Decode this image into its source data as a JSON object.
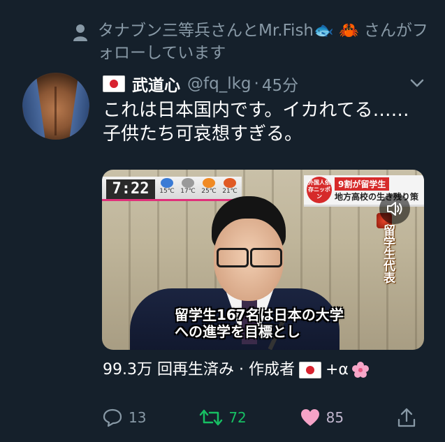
{
  "social_context": {
    "text": "タナブン三等兵さんとMr.Fish🐟 🦀 さんがフォローしています"
  },
  "tweet": {
    "display_name": "武道心",
    "handle": "@fq_lkg",
    "separator": "·",
    "time": "45分",
    "text": "これは日本国内です。イカれてる……子供たち可哀想すぎる。",
    "media": {
      "clock": "7:22",
      "weather": [
        {
          "label": "15℃",
          "icon": "rain-icon",
          "color": "#3a7bd5"
        },
        {
          "label": "17℃",
          "icon": "cloud-icon",
          "color": "#9a9a9a"
        },
        {
          "label": "25℃",
          "icon": "sun-icon",
          "color": "#f08a24"
        },
        {
          "label": "21℃",
          "icon": "sun-cloud-icon",
          "color": "#e05a24"
        }
      ],
      "banner_logo": "外国人依存ニッポン",
      "banner_line1": "9割が留学生",
      "banner_line2": "地方高校の生き残り策",
      "vertical_caption": "留学生代表",
      "subtitle": "留学生167名は日本の大学への進学を目標とし"
    },
    "views_text": "99.3万 回再生済み · 作成者",
    "views_suffix": "+α",
    "actions": {
      "reply_count": "13",
      "retweet_count": "72",
      "like_count": "85"
    }
  },
  "colors": {
    "background": "#15202b",
    "secondary_text": "#8899a6",
    "retweet_green": "#17bf63",
    "like_pink": "#e0245e"
  }
}
